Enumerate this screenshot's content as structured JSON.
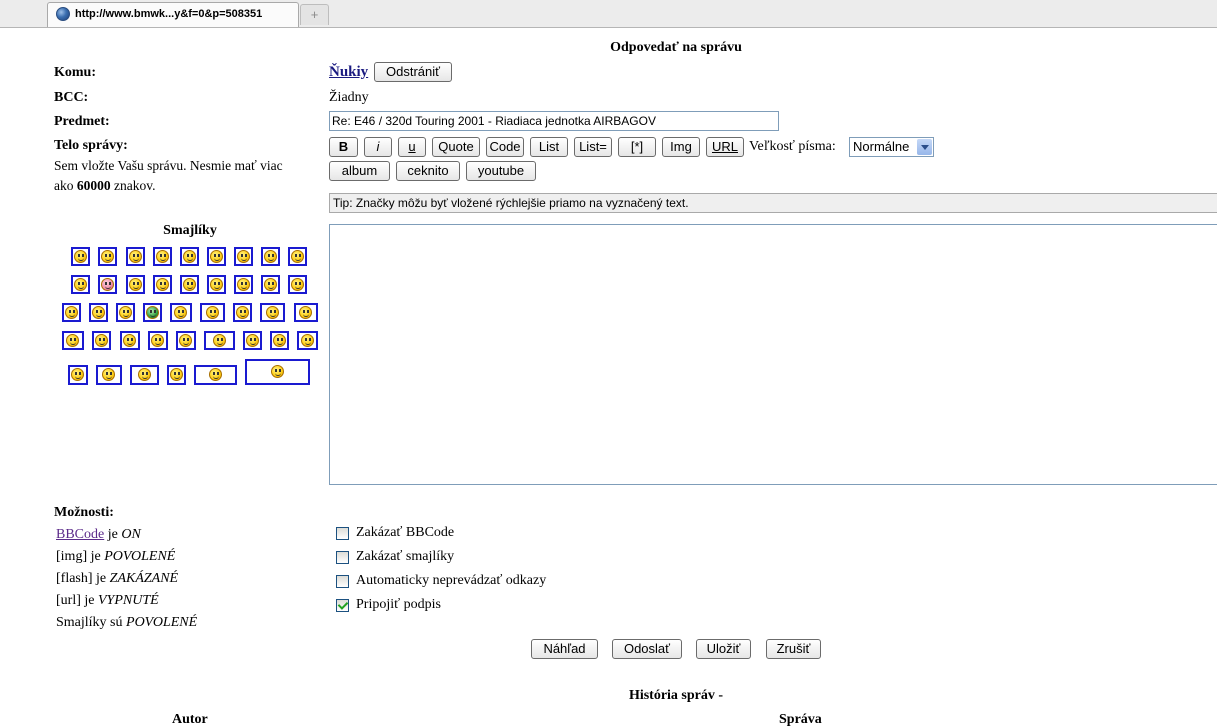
{
  "tab": {
    "title": "http://www.bmwk...y&f=0&p=508351",
    "new_tab_symbol": "+",
    "favicon": "globe-icon"
  },
  "form": {
    "heading": "Odpovedať na správu",
    "to_label": "Komu:",
    "to_value": "Ňukiy",
    "remove_button": "Odstrániť",
    "bcc_label": "BCC:",
    "bcc_value": "Žiadny",
    "subject_label": "Predmet:",
    "subject_value": "Re: E46 / 320d Touring 2001 - Riadiaca jednotka AIRBAGOV",
    "body_label": "Telo správy:",
    "body_hint_1": "Sem vložte Vašu správu. Nesmie mať viac",
    "body_hint_2a": "ako ",
    "body_hint_limit": "60000",
    "body_hint_2b": " znakov.",
    "font_size_label": "Veľkosť písma:",
    "font_size_value": "Normálne",
    "tip": "Tip: Značky môžu byť vložené rýchlejšie priamo na vyznačený text.",
    "message_value": ""
  },
  "toolbar": {
    "bold": "B",
    "italic": "i",
    "underline": "u",
    "quote": "Quote",
    "code": "Code",
    "list": "List",
    "list_ordered": "List=",
    "list_item": "[*]",
    "img": "Img",
    "url": "URL",
    "album": "album",
    "ceknito": "ceknito",
    "youtube": "youtube"
  },
  "smileys": {
    "title": "Smajlíky",
    "count": 43
  },
  "options": {
    "title": "Možnosti:",
    "bbcode_link": "BBCode",
    "bbcode_je": " je ",
    "bbcode_state": "ON",
    "img_prefix": "[img] je ",
    "img_state": "POVOLENÉ",
    "flash_prefix": "[flash] je ",
    "flash_state": "ZAKÁZANÉ",
    "url_prefix": "[url] je ",
    "url_state": "VYPNUTÉ",
    "smileys_prefix": "Smajlíky sú ",
    "smileys_state": "POVOLENÉ"
  },
  "checkboxes": [
    {
      "label": "Zakázať BBCode",
      "checked": false
    },
    {
      "label": "Zakázať smajlíky",
      "checked": false
    },
    {
      "label": "Automaticky neprevádzať odkazy",
      "checked": false
    },
    {
      "label": "Pripojiť podpis",
      "checked": true
    }
  ],
  "actions": {
    "preview": "Náhľad",
    "send": "Odoslať",
    "save": "Uložiť",
    "cancel": "Zrušiť"
  },
  "history": {
    "title": "História správ -",
    "col_author": "Autor",
    "col_message": "Správa"
  },
  "colors": {
    "smiley_border": "#1a1ad0",
    "link_visited": "#5b2a8a",
    "checkbox_check": "#21a121"
  }
}
